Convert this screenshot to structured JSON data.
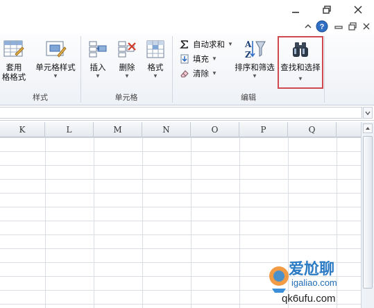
{
  "ribbon": {
    "groups": {
      "styles_label": "样式",
      "cells_label": "单元格",
      "editing_label": "编辑"
    },
    "styles": {
      "table_format_line1": "套用",
      "table_format_line2": "格格式",
      "cell_styles": "单元格样式"
    },
    "cells": {
      "insert": "插入",
      "delete": "删除",
      "format": "格式"
    },
    "editing": {
      "autosum": "自动求和",
      "fill": "填充",
      "clear": "清除",
      "sort_filter": "排序和筛选",
      "find_select": "查找和选择"
    }
  },
  "grid": {
    "columns": [
      "K",
      "L",
      "M",
      "N",
      "O",
      "P",
      "Q"
    ]
  },
  "watermark": {
    "line1": "爱尬聊",
    "line2": "igaliao.com",
    "line3": "qk6ufu.com"
  },
  "colors": {
    "highlight_border": "#d0494f",
    "help_icon": "#2f6fc4",
    "ribbon_bg": "#eef1f6"
  }
}
